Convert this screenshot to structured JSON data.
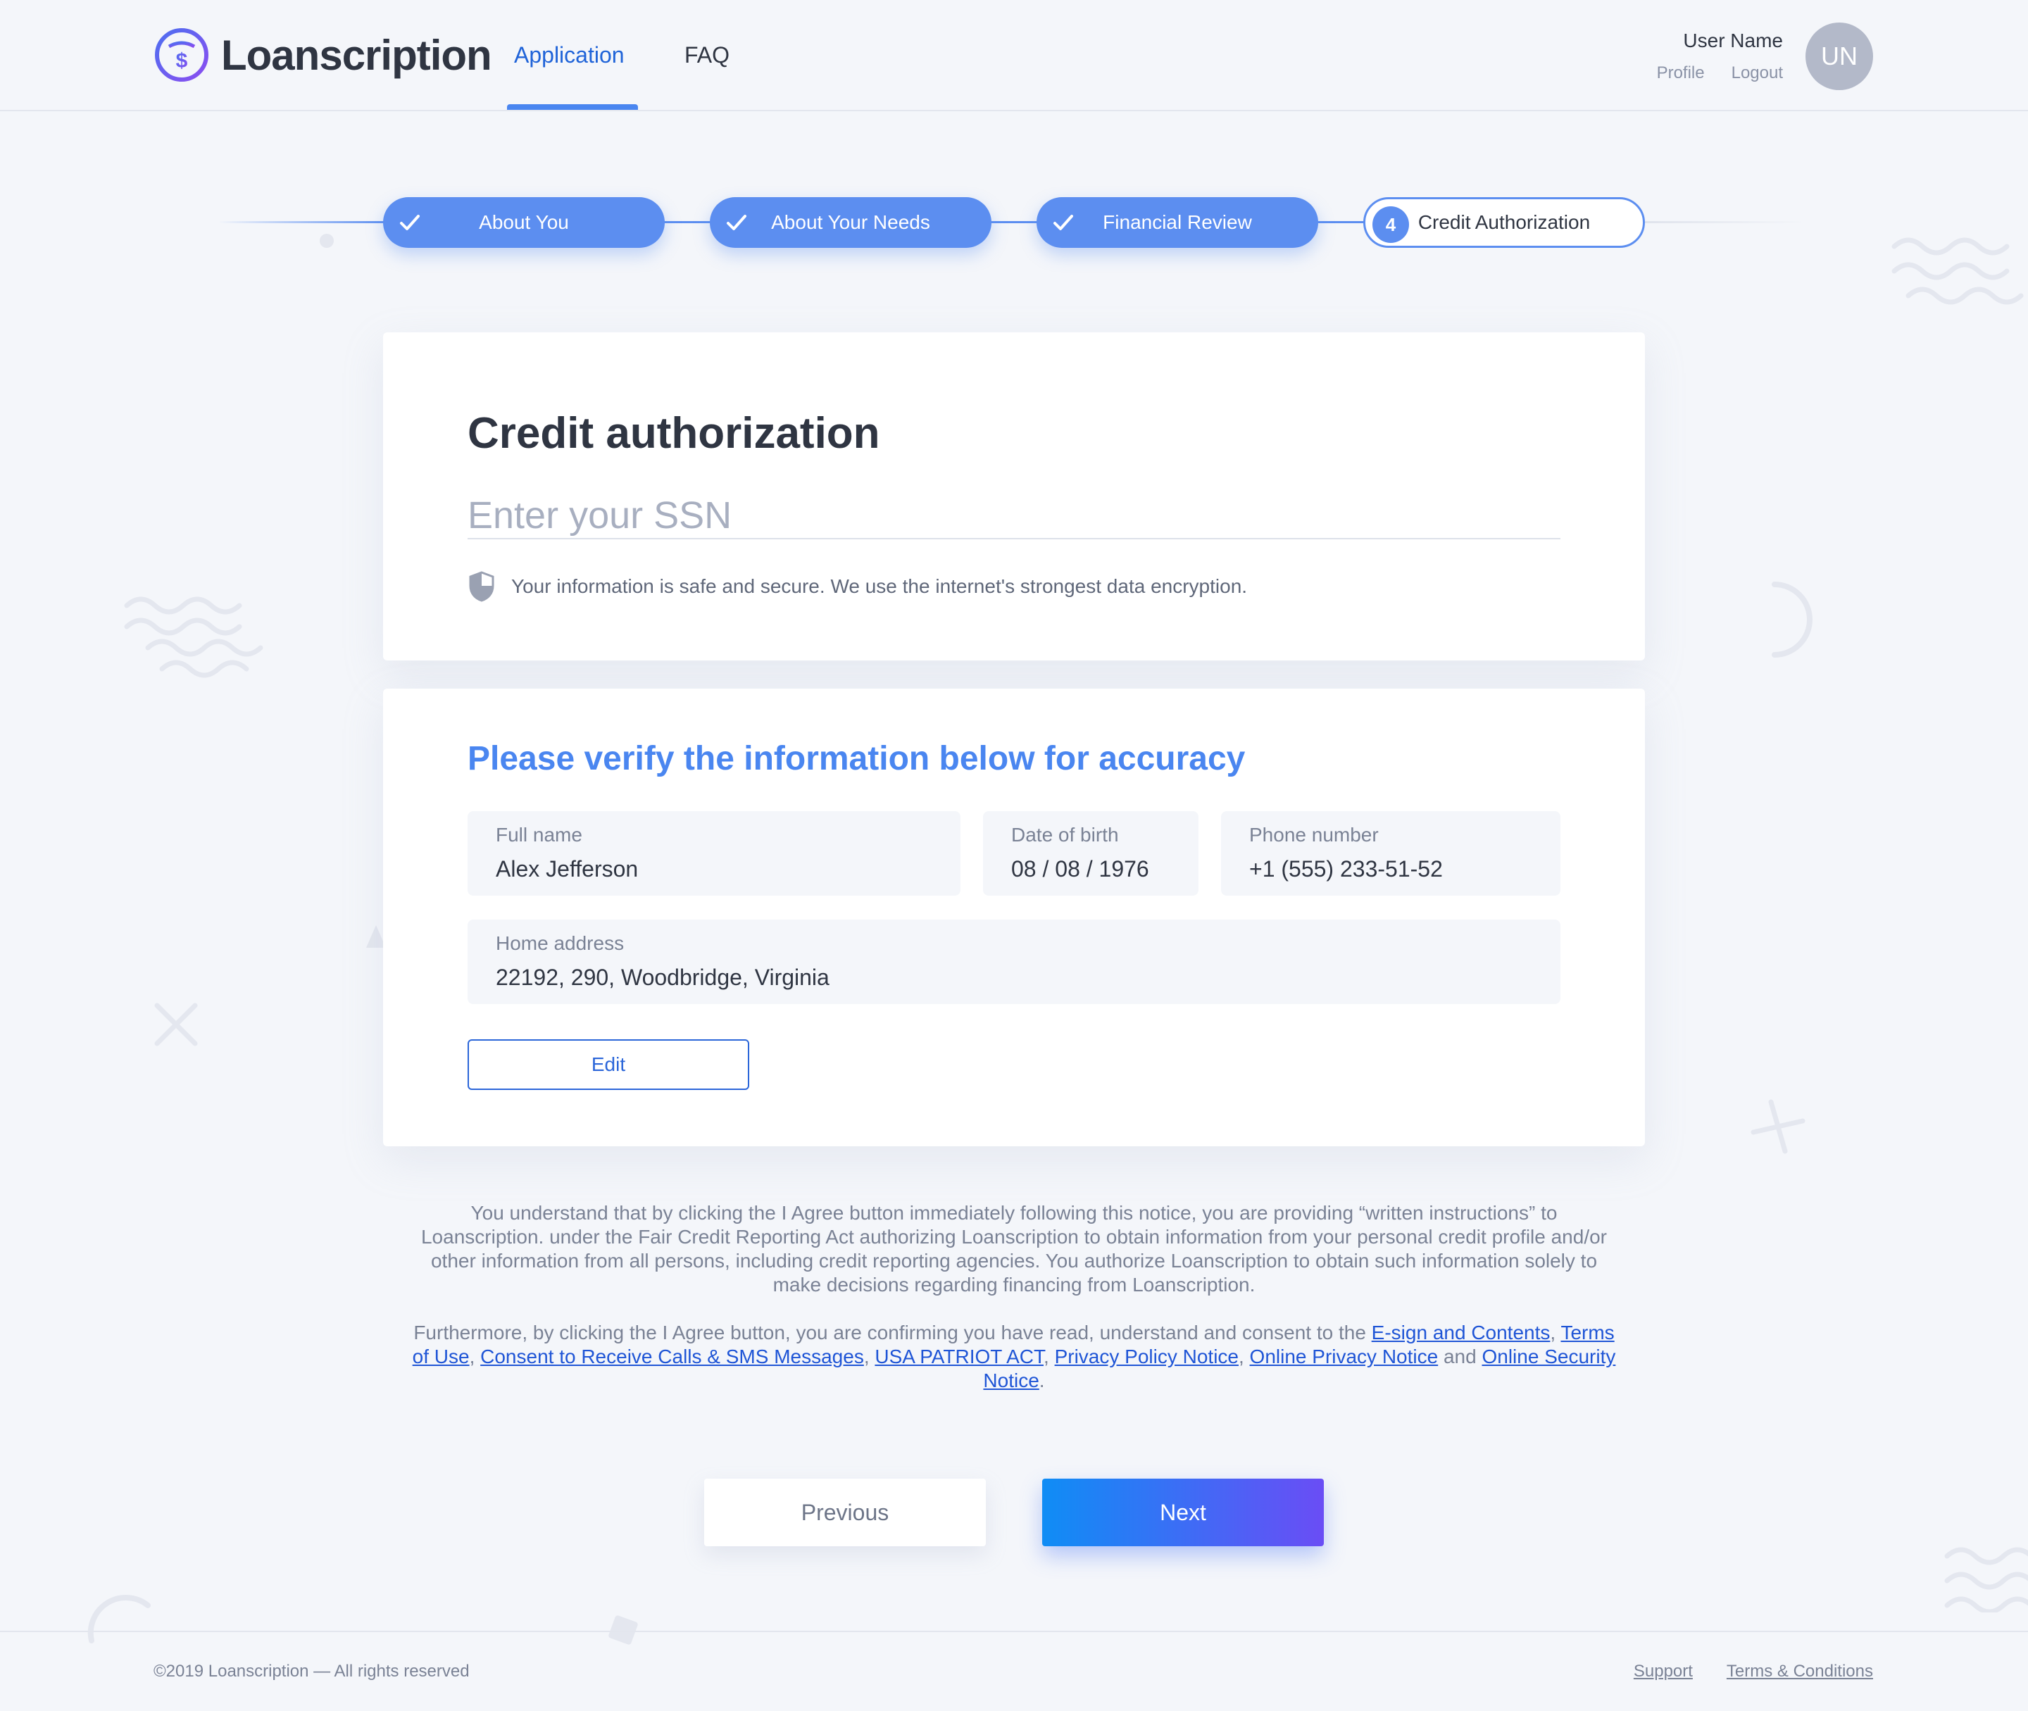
{
  "brand": {
    "name": "Loanscription",
    "accent": "#5c8ef0",
    "link": "#1f55d6"
  },
  "nav": {
    "application": "Application",
    "faq": "FAQ"
  },
  "user": {
    "name": "User Name",
    "profile": "Profile",
    "logout": "Logout",
    "initials": "UN"
  },
  "steps": [
    {
      "label": "About You",
      "status": "done"
    },
    {
      "label": "About Your Needs",
      "status": "done"
    },
    {
      "label": "Financial Review",
      "status": "done"
    },
    {
      "label": "Credit Authorization",
      "status": "active",
      "number": "4"
    }
  ],
  "credit": {
    "title": "Credit authorization",
    "ssn_placeholder": "Enter your SSN",
    "ssn_value": "",
    "secure_note": "Your information is safe and secure. We use the internet's strongest data encryption."
  },
  "verify": {
    "title": "Please verify the information below for accuracy",
    "full_name_label": "Full name",
    "full_name": "Alex Jefferson",
    "dob_label": "Date of birth",
    "dob": "08 / 08 / 1976",
    "phone_label": "Phone number",
    "phone": "+1 (555) 233-51-52",
    "address_label": "Home address",
    "address": "22192, 290, Woodbridge, Virginia",
    "edit": "Edit"
  },
  "notice": {
    "p1": "You understand that by clicking the I Agree button immediately following this notice, you are providing “written instructions” to Loanscription. under the Fair Credit Reporting Act authorizing Loanscription to obtain information from your personal credit profile and/or other information from all persons, including credit reporting agencies. You authorize Loanscription to obtain such information solely to make decisions regarding financing from Loanscription.",
    "p2_intro": "Furthermore, by clicking the I Agree button, you are confirming you have read, understand and consent to the ",
    "link_esign": "E-sign and Contents",
    "sep": ", ",
    "link_terms": "Terms of Use",
    "link_consent": "Consent to Receive Calls & SMS Messages",
    "link_patriot": "USA PATRIOT ACT",
    "link_privacy_policy": "Privacy Policy Notice",
    "link_online_privacy": "Online Privacy Notice",
    "and": " and ",
    "link_security": "Online Security Notice",
    "end": "."
  },
  "buttons": {
    "previous": "Previous",
    "next": "Next"
  },
  "footer": {
    "copyright": "©2019 Loanscription — All rights reserved",
    "support": "Support",
    "terms": "Terms & Conditions"
  }
}
